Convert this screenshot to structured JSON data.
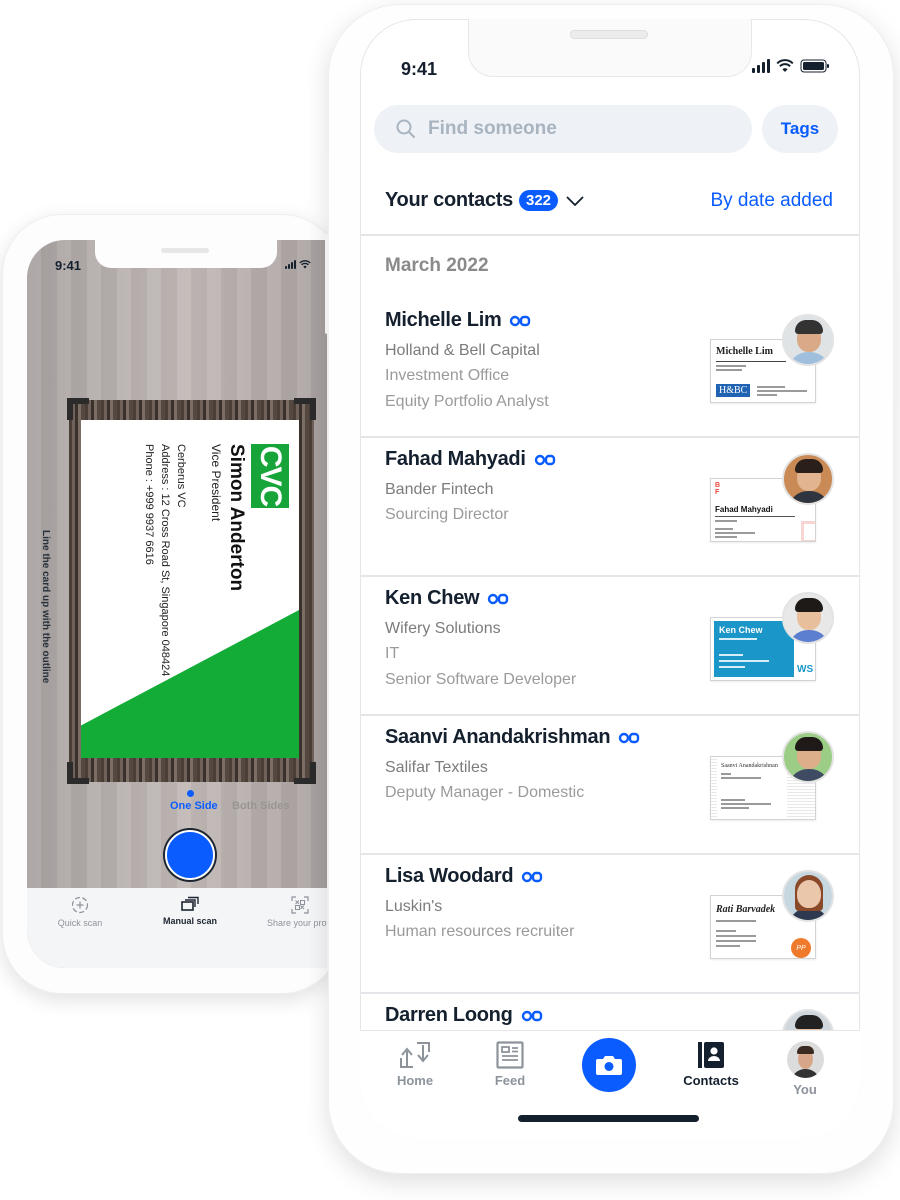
{
  "scanner_phone": {
    "status_time": "9:41",
    "card": {
      "logo": "CVC",
      "name": "Simon Anderton",
      "title": "Vice President",
      "company": "Cerberus VC",
      "address": "Address : 12 Cross Road St, Singapore 048424",
      "phone": "Phone : +999 9937 6616",
      "accent_color": "#12ac37"
    },
    "hint": "Line the card up with the outline",
    "side_options": [
      {
        "label": "One Side",
        "selected": true
      },
      {
        "label": "Both Sides",
        "selected": false
      }
    ],
    "bottom_tabs": [
      {
        "label": "Quick scan",
        "icon": "quick-scan-icon",
        "active": false
      },
      {
        "label": "Manual scan",
        "icon": "manual-scan-icon",
        "active": true
      },
      {
        "label": "Share your profil",
        "icon": "qr-code-icon",
        "active": false
      }
    ]
  },
  "contacts_phone": {
    "status_time": "9:41",
    "search": {
      "placeholder": "Find someone"
    },
    "tags_label": "Tags",
    "header": {
      "title": "Your contacts",
      "count": "322",
      "sort_label": "By date added"
    },
    "section_label": "March 2022",
    "contacts": [
      {
        "name": "Michelle Lim",
        "lines": [
          "Holland & Bell Capital",
          "Investment Office",
          "Equity Portfolio Analyst"
        ],
        "card": {
          "name": "Michelle Lim",
          "logo": "H&BC",
          "style": "hbc"
        }
      },
      {
        "name": "Fahad Mahyadi",
        "lines": [
          "Bander Fintech",
          "Sourcing Director"
        ],
        "card": {
          "name": "Fahad Mahyadi",
          "logo": "BF",
          "style": "bf"
        }
      },
      {
        "name": "Ken Chew",
        "lines": [
          "Wifery Solutions",
          "IT",
          "Senior Software Developer"
        ],
        "card": {
          "name": "Ken Chew",
          "logo": "WS",
          "style": "ws"
        }
      },
      {
        "name": "Saanvi Anandakrishman",
        "lines": [
          "Salifar Textiles",
          "Deputy Manager - Domestic"
        ],
        "card": {
          "name": "Saanvi Anandakrishnan",
          "logo": "",
          "style": "grid"
        }
      },
      {
        "name": "Lisa Woodard",
        "lines": [
          "Luskin's",
          "Human resources recruiter"
        ],
        "card": {
          "name": "Rati Barvadek",
          "logo": "PP",
          "style": "script"
        }
      },
      {
        "name": "Darren Loong",
        "lines": [],
        "card": {
          "name": "",
          "logo": "",
          "style": "plain"
        }
      }
    ],
    "bottom_nav": [
      {
        "label": "Home",
        "icon": "home-transfer-icon",
        "active": false
      },
      {
        "label": "Feed",
        "icon": "feed-icon",
        "active": false
      },
      {
        "label": "",
        "icon": "camera-icon",
        "active": false
      },
      {
        "label": "Contacts",
        "icon": "contacts-book-icon",
        "active": true
      },
      {
        "label": "You",
        "icon": "avatar",
        "active": false
      }
    ],
    "colors": {
      "accent": "#0a5cff",
      "text_primary": "#15202e",
      "text_secondary": "#9a9a9a"
    }
  }
}
